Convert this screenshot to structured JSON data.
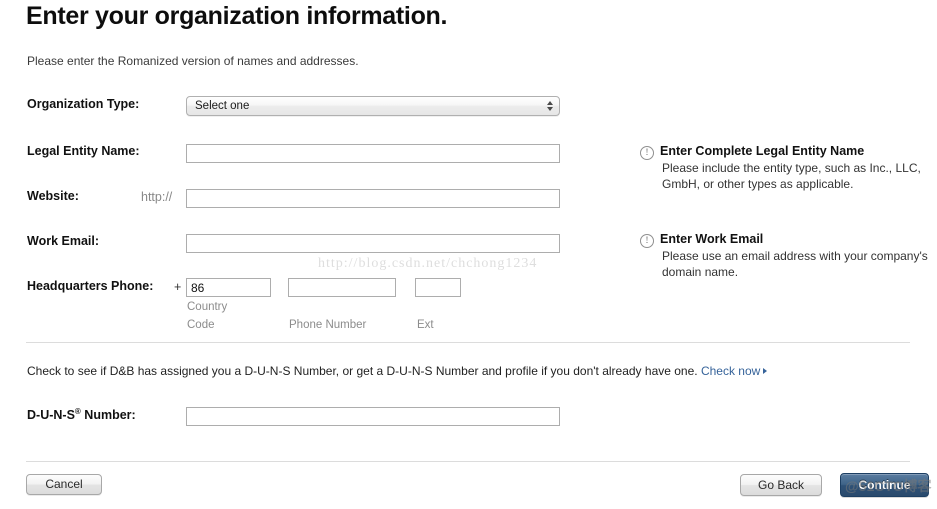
{
  "header": {
    "title": "Enter your organization information.",
    "subtitle": "Please enter the Romanized version of names and addresses."
  },
  "form": {
    "org_type": {
      "label": "Organization Type:",
      "selected": "Select one",
      "options": [
        "Select one"
      ]
    },
    "legal_entity": {
      "label": "Legal Entity Name:",
      "value": "",
      "placeholder": ""
    },
    "website": {
      "label": "Website:",
      "prefix": "http://",
      "value": "",
      "placeholder": ""
    },
    "work_email": {
      "label": "Work Email:",
      "value": "",
      "placeholder": ""
    },
    "phone": {
      "label": "Headquarters Phone:",
      "plus": "+",
      "country_code_value": "86",
      "country_code_sublabel_line1": "Country",
      "country_code_sublabel_line2": "Code",
      "number_value": "",
      "number_sublabel": "Phone Number",
      "ext_value": "",
      "ext_sublabel": "Ext"
    },
    "duns": {
      "note_text": "Check to see if D&B has assigned you a D-U-N-S Number, or get a D-U-N-S Number and profile if you don't already have one.",
      "link_label": "Check now",
      "label_main": "D-U-N-S",
      "label_sup": "®",
      "label_suffix": " Number:",
      "value": "",
      "placeholder": ""
    }
  },
  "help": [
    {
      "icon": "exclamation-circle-icon",
      "title": "Enter Complete Legal Entity Name",
      "body": "Please include the entity type, such as Inc., LLC, GmbH, or other types as applicable."
    },
    {
      "icon": "exclamation-circle-icon",
      "title": "Enter Work Email",
      "body": "Please use an email address with your company's domain name."
    }
  ],
  "footer": {
    "cancel_label": "Cancel",
    "go_back_label": "Go Back",
    "continue_label": "Continue"
  },
  "watermarks": {
    "url": "http://blog.csdn.net/chchong1234",
    "site": "@51CTO博客"
  },
  "colors": {
    "link_blue": "#36639a",
    "primary_button": "#2f5277",
    "label_text": "#111111",
    "muted_text": "#8c8c8c"
  }
}
